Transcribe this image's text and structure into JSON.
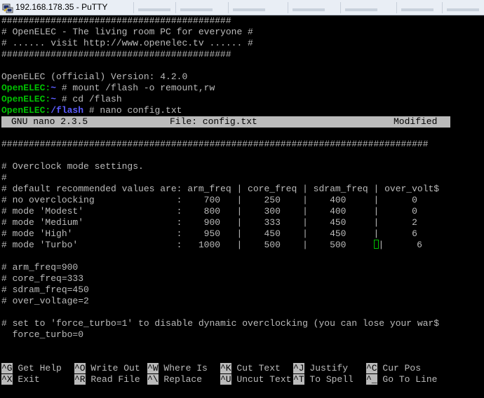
{
  "window": {
    "title": "192.168.178.35 - PuTTY"
  },
  "terminal": {
    "lines": [
      {
        "text": "##########################################"
      },
      {
        "text": "# OpenELEC - The living room PC for everyone #"
      },
      {
        "text": "# ...... visit http://www.openelec.tv ...... #"
      },
      {
        "text": "##########################################"
      },
      {
        "text": ""
      },
      {
        "text": "OpenELEC (official) Version: 4.2.0"
      },
      {
        "host": "OpenELEC:",
        "path": "~",
        "cmd": " # mount /flash -o remount,rw"
      },
      {
        "host": "OpenELEC:",
        "path": "~",
        "cmd": " # cd /flash"
      },
      {
        "host": "OpenELEC:",
        "path": "/flash",
        "cmd": " # nano config.txt"
      }
    ],
    "nano_header": {
      "version": "GNU nano 2.3.5",
      "file": "File: config.txt",
      "status": "Modified"
    },
    "content": [
      "##############################################################################",
      "",
      "# Overclock mode settings.",
      "#",
      "# default recommended values are: arm_freq | core_freq | sdram_freq | over_volt$",
      "# no overclocking               :    700   |    250    |    400     |      0",
      "# mode 'Modest'                 :    800   |    300    |    400     |      0",
      "# mode 'Medium'                 :    900   |    333    |    450     |      2",
      "# mode 'High'                   :    950   |    450    |    450     |      6",
      {
        "before": "# mode 'Turbo'                  :   1000   |    500    |    500     ",
        "after": "|      6"
      },
      "",
      "# arm_freq=900",
      "# core_freq=333",
      "# sdram_freq=450",
      "# over_voltage=2",
      "",
      "# set to 'force_turbo=1' to disable dynamic overclocking (you can lose your war$",
      "  force_turbo=0"
    ],
    "shortcuts_row1": [
      {
        "key": "^G",
        "label": " Get Help"
      },
      {
        "key": "^O",
        "label": " Write Out"
      },
      {
        "key": "^W",
        "label": " Where Is"
      },
      {
        "key": "^K",
        "label": " Cut Text"
      },
      {
        "key": "^J",
        "label": " Justify"
      },
      {
        "key": "^C",
        "label": " Cur Pos"
      }
    ],
    "shortcuts_row2": [
      {
        "key": "^X",
        "label": " Exit"
      },
      {
        "key": "^R",
        "label": " Read File"
      },
      {
        "key": "^\\",
        "label": " Replace"
      },
      {
        "key": "^U",
        "label": " Uncut Text"
      },
      {
        "key": "^T",
        "label": " To Spell"
      },
      {
        "key": "^_",
        "label": " Go To Line"
      }
    ]
  },
  "colors": {
    "background": "#000000",
    "text": "#bbbbbb",
    "prompt_host": "#00c000",
    "prompt_path": "#5c5cff",
    "inverse_bg": "#bbbbbb"
  },
  "icons": {
    "app": "putty-icon"
  }
}
